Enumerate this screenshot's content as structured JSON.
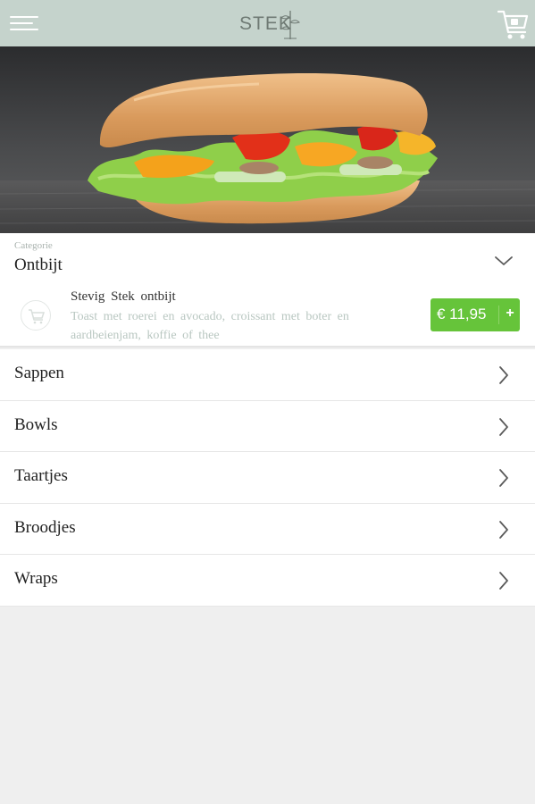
{
  "header": {
    "logo_text": "STEK",
    "menu_icon": "hamburger-menu-icon",
    "cart_icon": "shopping-cart-icon",
    "bar_color": "#c5d3cc"
  },
  "hero": {
    "image": "sandwich-photo"
  },
  "category": {
    "label": "Categorie",
    "selected": "Ontbijt",
    "expand_icon": "chevron-down-icon"
  },
  "product": {
    "name": "Stevig Stek ontbijt",
    "description": "Toast met roerei en avocado, croissant met boter en aardbeienjam, koffie of thee",
    "price": "€ 11,95",
    "add_label": "+",
    "price_color": "#66c43a"
  },
  "categories": [
    {
      "label": "Sappen"
    },
    {
      "label": "Bowls"
    },
    {
      "label": "Taartjes"
    },
    {
      "label": "Broodjes"
    },
    {
      "label": "Wraps"
    }
  ]
}
